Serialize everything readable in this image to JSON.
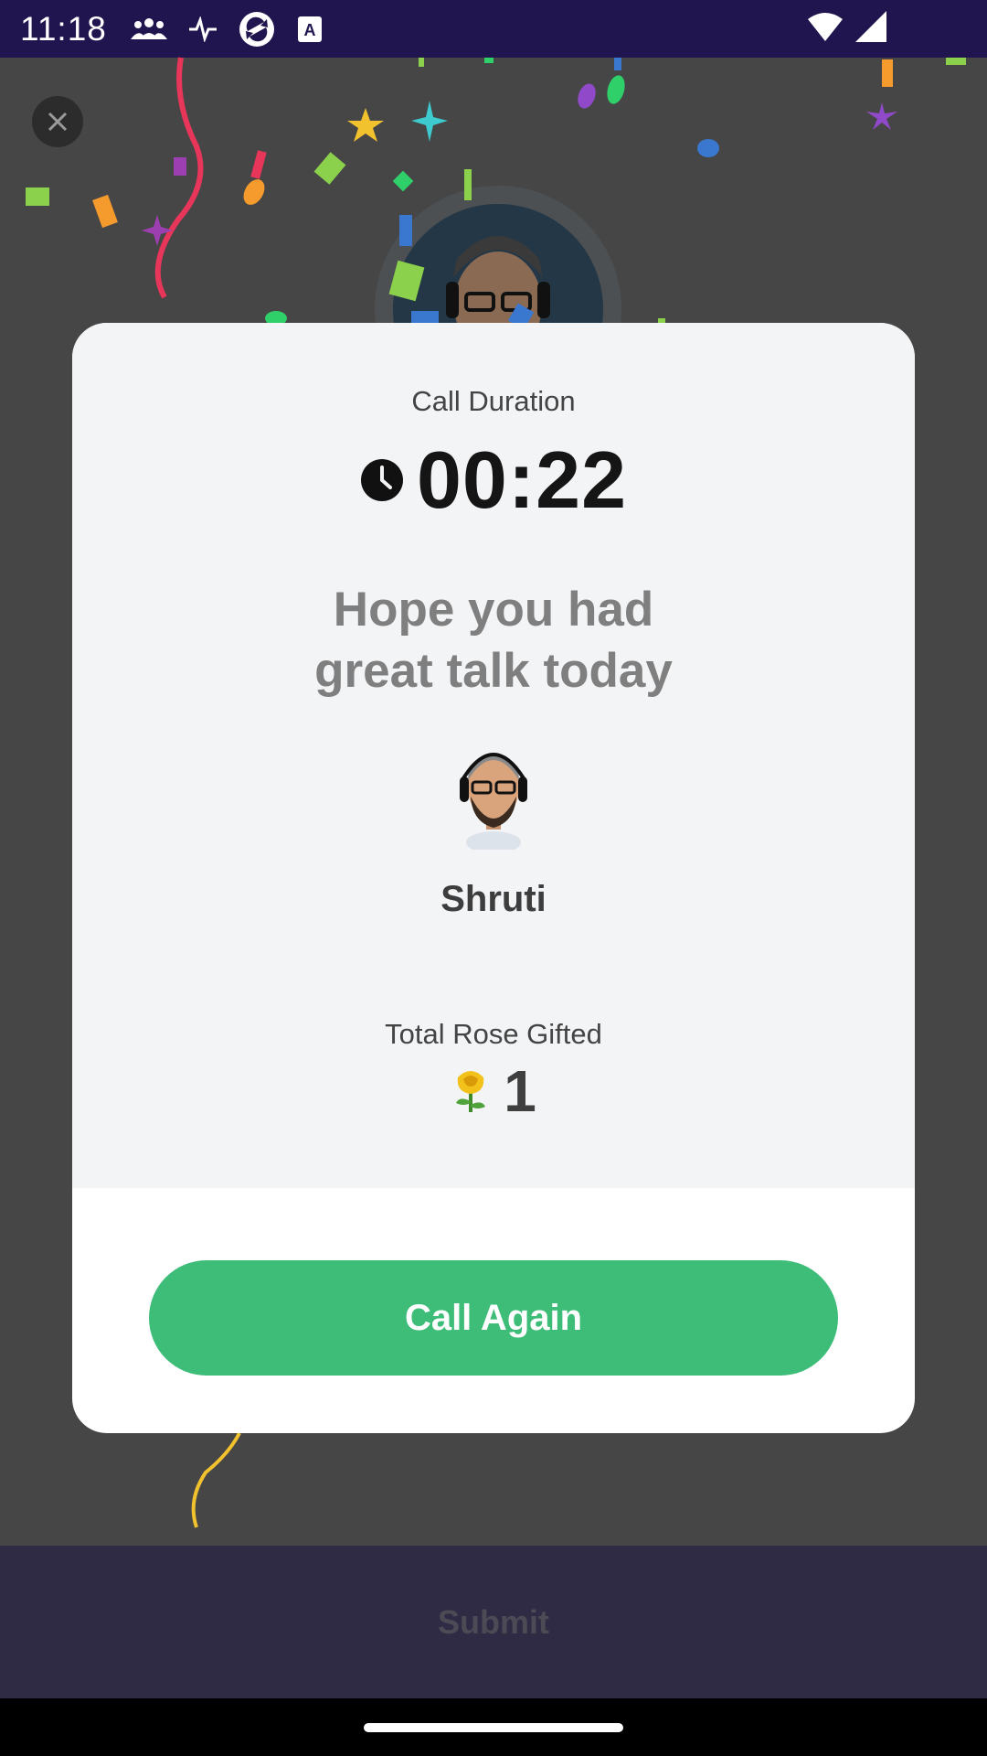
{
  "status_bar": {
    "time": "11:18",
    "icons_left": [
      "group-icon",
      "pulse-icon",
      "sync-app-icon",
      "text-a-icon"
    ],
    "icons_right": [
      "wifi-icon",
      "cellular-icon"
    ]
  },
  "background": {
    "close_icon": "close-icon",
    "avatar": "caller-avatar-large"
  },
  "card": {
    "duration_label": "Call Duration",
    "duration_value": "00:22",
    "clock_icon": "clock-icon",
    "message_line1": "Hope you had",
    "message_line2": "great talk today",
    "caller_name": "Shruti",
    "rose_label": "Total Rose Gifted",
    "rose_icon": "rose-icon",
    "rose_count": "1",
    "call_again_label": "Call Again"
  },
  "footer": {
    "submit_label": "Submit"
  },
  "colors": {
    "status_bar": "#21154f",
    "backdrop": "#464646",
    "card_top": "#f3f4f6",
    "call_again": "#3dbd78",
    "submit_bar": "#2f2b45"
  }
}
